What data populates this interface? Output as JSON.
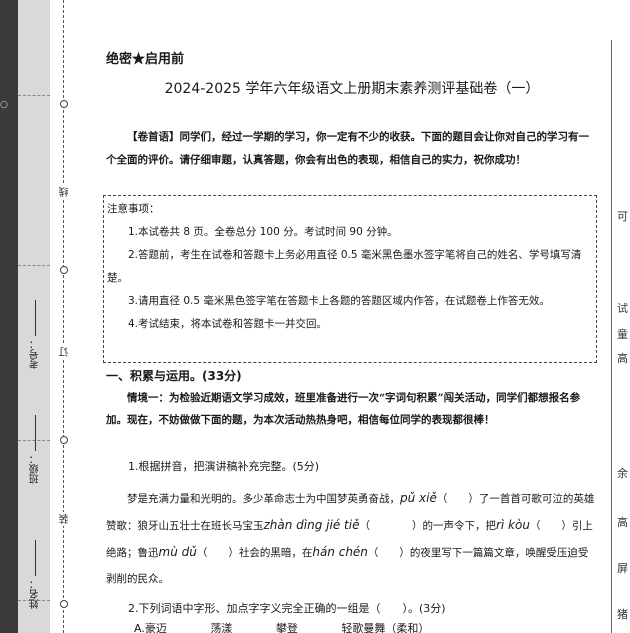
{
  "binding": {
    "name_label": "姓名：",
    "class_label": "班级：",
    "exam_no_label": "考号：",
    "cut_marks": [
      "线",
      "订",
      "装"
    ]
  },
  "header": {
    "secret": "绝密★启用前",
    "title": "2024-2025 学年六年级语文上册期末素养测评基础卷（一）"
  },
  "foreword": "【卷首语】同学们，经过一学期的学习，你一定有不少的收获。下面的题目会让你对自己的学习有一个全面的评价。请仔细审题，认真答题，你会有出色的表现，相信自己的实力，祝你成功！",
  "notes": {
    "heading": "注意事项：",
    "items": [
      "1.本试卷共 8 页。全卷总分 100 分。考试时间 90 分钟。",
      "2.答题前，考生在试卷和答题卡上务必用直径 0.5 毫米黑色墨水签字笔将自己的姓名、学号填写清楚。",
      "3.请用直径 0.5 毫米黑色签字笔在答题卡上各题的答题区域内作答，在试题卷上作答无效。",
      "4.考试结束，将本试卷和答题卡一并交回。"
    ]
  },
  "section1": {
    "heading": "一、积累与运用。(33分)",
    "scene": "情境一：为检验近期语文学习成效，班里准备进行一次“字词句积累”闯关活动，同学们都想报名参加。现在，不妨做做下面的题，为本次活动热热身吧，相信每位同学的表现都很棒！",
    "q1": "1.根据拼音，把演讲稿补充完整。(5分)",
    "passage": {
      "t1": "梦是充满力量和光明的。多少革命志士为中国梦英勇奋战，",
      "p1": "pǔ xiě",
      "t2": "（　　）了一首首可歌可泣的英雄赞歌：狼牙山五壮士在班长马宝玉",
      "p2": "zhàn dìng jié tiě",
      "t3": "（　　　　）的一声令下，把",
      "p3": "rì kòu",
      "t4": "（　　）引上绝路；鲁迅",
      "p4": "mù dǔ",
      "t5": "（　　）社会的黑暗，在",
      "p5": "hán chén",
      "t6": "（　　）的夜里写下一篇篇文章，唤醒受压迫受剥削的民众。"
    },
    "q2": "2.下列词语中字形、加点字字义完全正确的一组是（　　）。(3分)",
    "q2_options": [
      "A.豪迈",
      "荡漾",
      "攀登",
      "轻歌曼舞（柔和）"
    ]
  },
  "right_edge": [
    "可",
    "试",
    "童",
    "高",
    "余",
    "高",
    "屏",
    "猪"
  ]
}
